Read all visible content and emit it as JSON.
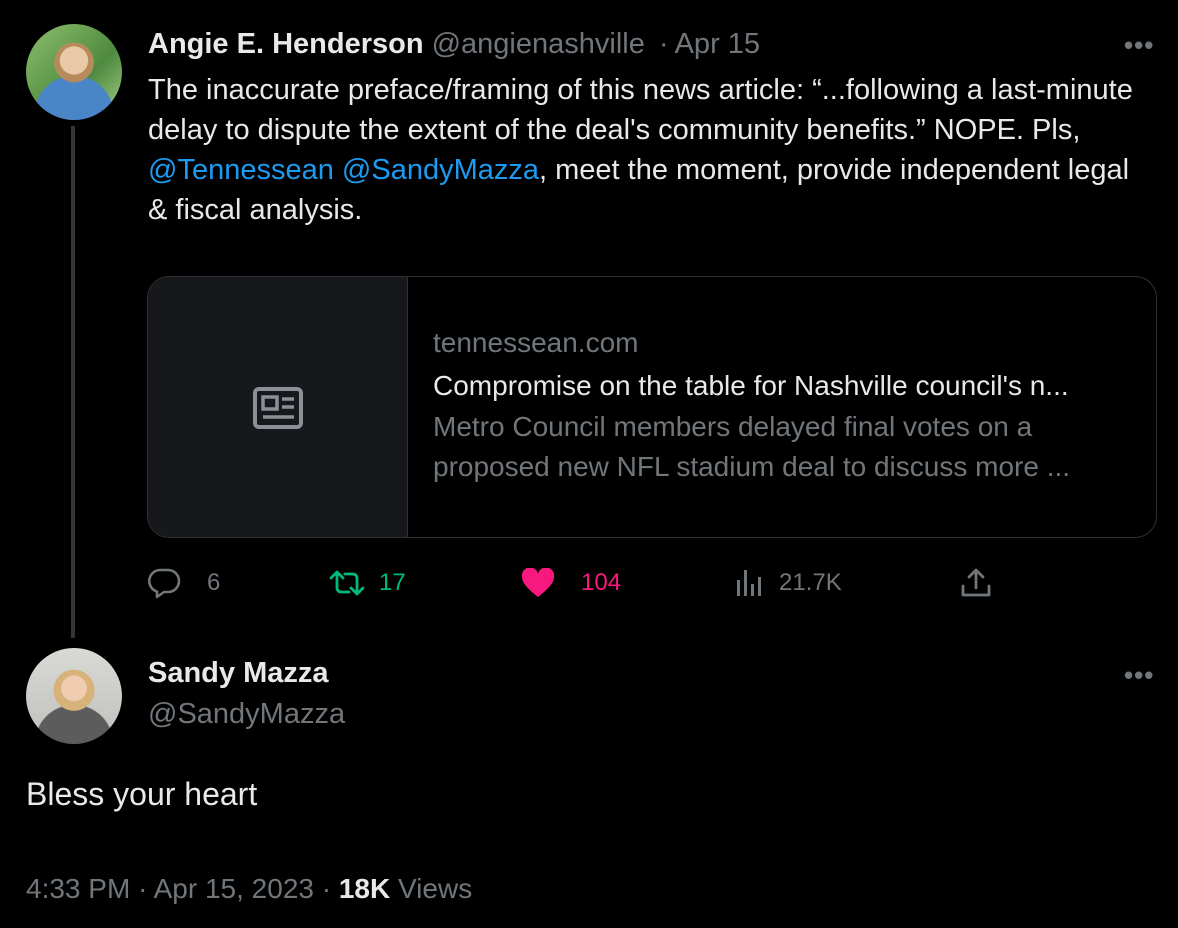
{
  "tweet1": {
    "author_name": "Angie E. Henderson",
    "author_handle": "@angienashville",
    "separator": "·",
    "date": "Apr 15",
    "more_label": "•••",
    "text_before_mentions": "The inaccurate preface/framing of this news article: “...following a last-minute delay to dispute the extent of the deal's community benefits.” NOPE. Pls, ",
    "mention1": "@Tennessean",
    "mention2": "@SandyMazza",
    "text_after_mentions": ", meet the moment, provide independent legal & fiscal analysis.",
    "card": {
      "domain": "tennessean.com",
      "title": "Compromise on the table for Nashville council's n...",
      "description": "Metro Council members delayed final votes on a proposed new NFL stadium deal to discuss more ..."
    },
    "actions": {
      "replies": "6",
      "retweets": "17",
      "likes": "104",
      "views": "21.7K"
    }
  },
  "tweet2": {
    "author_name": "Sandy Mazza",
    "author_handle": "@SandyMazza",
    "more_label": "•••",
    "text": "Bless your heart",
    "time": "4:33 PM",
    "dot1": "·",
    "date": "Apr 15, 2023",
    "dot2": "·",
    "views_count": "18K",
    "views_label": "Views"
  },
  "colors": {
    "background": "#000000",
    "text": "#e7e9ea",
    "muted": "#71767b",
    "link": "#1d9bf0",
    "retweet_active": "#00ba7c",
    "like_active": "#f91880"
  },
  "icons": [
    "reply-icon",
    "retweet-icon",
    "like-icon",
    "views-icon",
    "share-icon",
    "news-article-icon",
    "more-icon"
  ]
}
